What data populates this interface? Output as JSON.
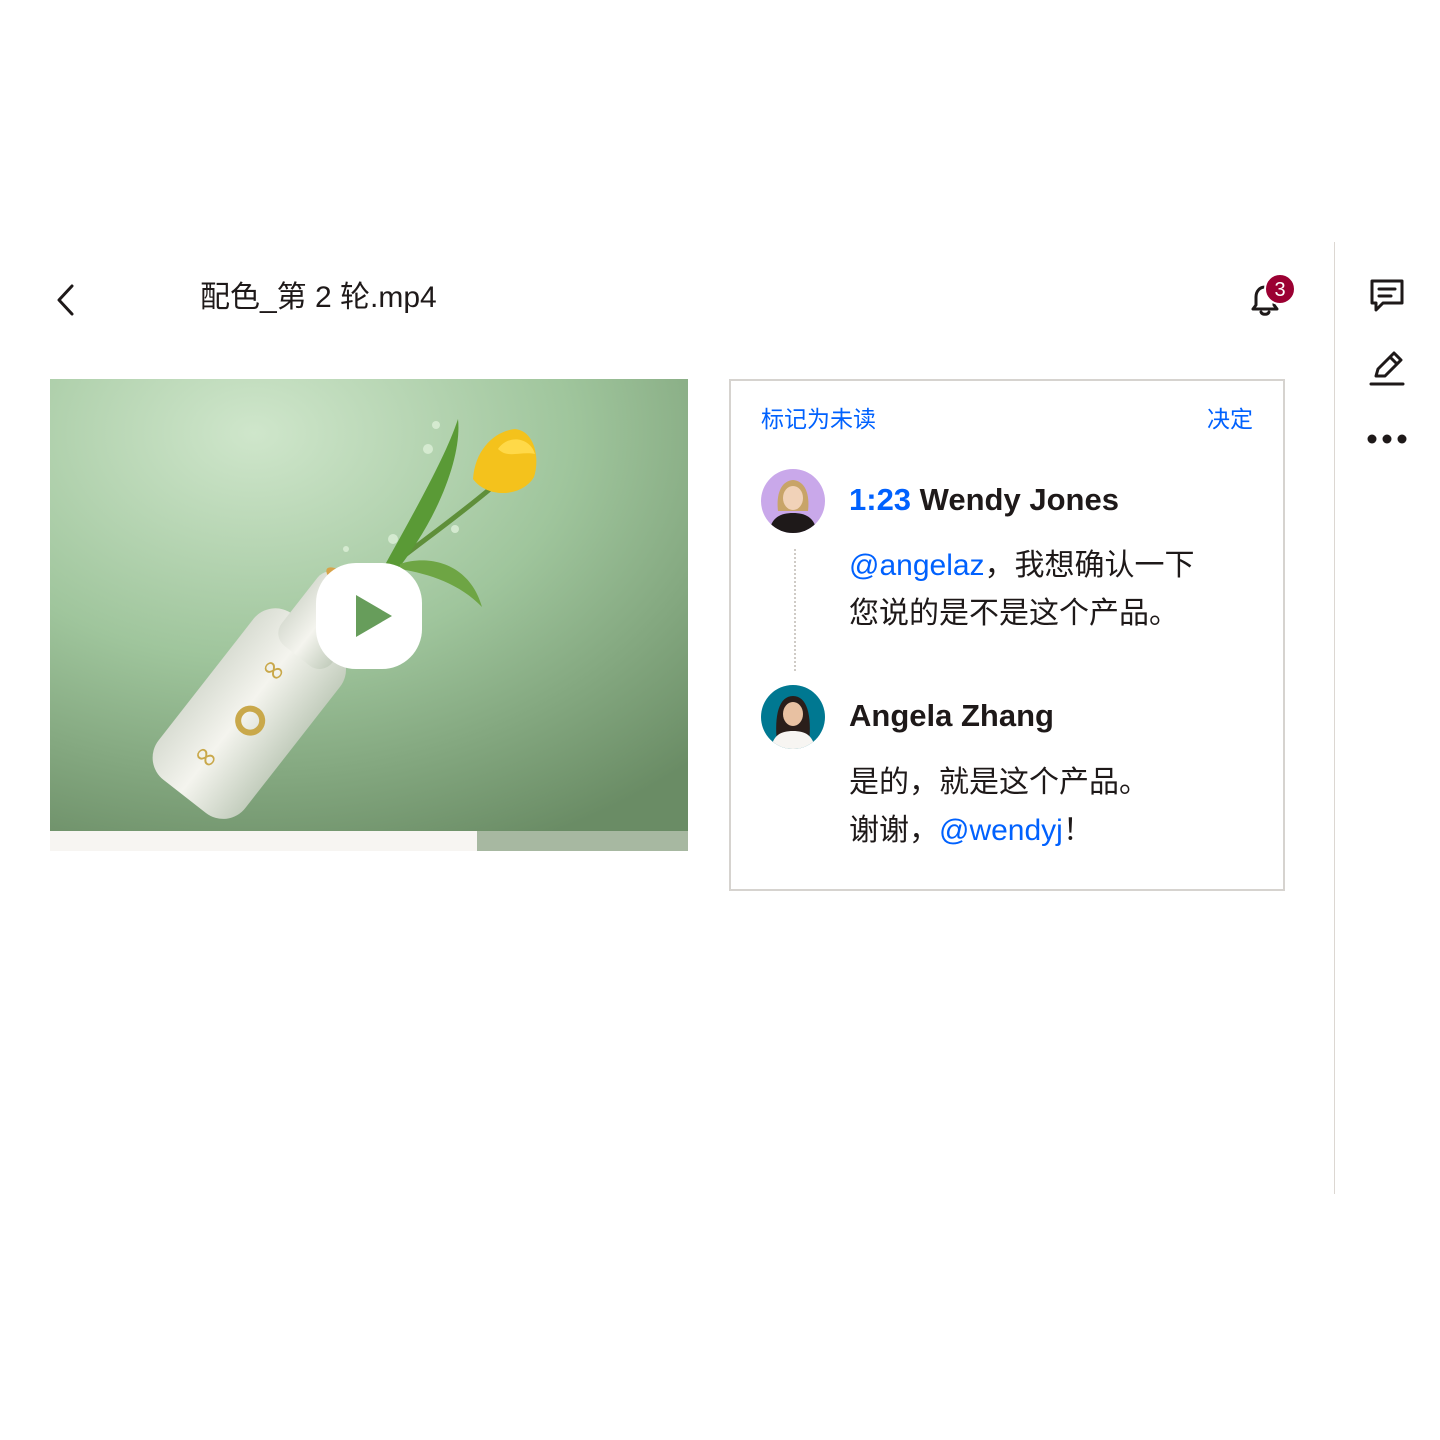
{
  "header": {
    "back_icon": "chevron-left-icon",
    "file_name": "配色_第 2 轮.mp4",
    "notifications": {
      "icon": "bell-icon",
      "count": "3"
    }
  },
  "side_rail": {
    "items": [
      {
        "icon": "comment-icon"
      },
      {
        "icon": "pencil-icon"
      },
      {
        "icon": "more-horizontal-icon"
      }
    ]
  },
  "video": {
    "play_icon": "play-icon",
    "progress_fraction": 0.67
  },
  "comments_panel": {
    "mark_unread": "标记为未读",
    "resolve": "决定",
    "comments": [
      {
        "timestamp": "1:23",
        "author": "Wendy Jones",
        "mention": "@angelaz",
        "text_after_mention": "，我想确认一下",
        "line2": "您说的是不是这个产品。"
      },
      {
        "author": "Angela Zhang",
        "line1": "是的，就是这个产品。",
        "line2_prefix": "谢谢，",
        "mention": "@wendyj",
        "line2_suffix": "！"
      }
    ]
  },
  "colors": {
    "accent": "#0061fe",
    "badge": "#9b0032",
    "text": "#1e1919",
    "video_bg": "#9cc29a"
  }
}
